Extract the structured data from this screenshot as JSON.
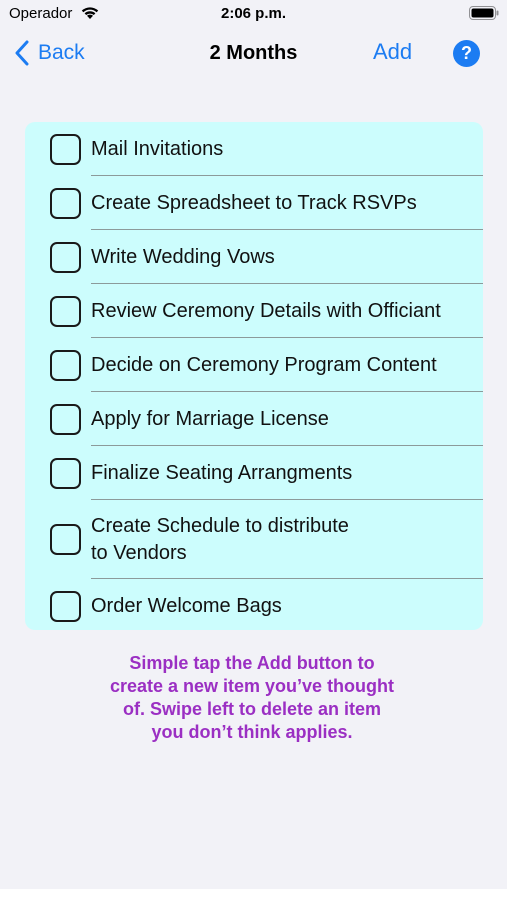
{
  "status_bar": {
    "carrier": "Operador",
    "time": "2:06 p.m."
  },
  "nav": {
    "back_label": "Back",
    "title": "2 Months",
    "add_label": "Add",
    "help_label": "?"
  },
  "checklist": {
    "items": [
      {
        "label": "Mail Invitations",
        "checked": false
      },
      {
        "label": "Create Spreadsheet to Track RSVPs",
        "checked": false
      },
      {
        "label": "Write Wedding Vows",
        "checked": false
      },
      {
        "label": "Review Ceremony Details with Officiant",
        "checked": false
      },
      {
        "label": "Decide on Ceremony Program Content",
        "checked": false
      },
      {
        "label": "Apply for Marriage License",
        "checked": false
      },
      {
        "label": "Finalize Seating Arrangments",
        "checked": false
      },
      {
        "label": "Create Schedule to distribute\nto Vendors",
        "checked": false
      },
      {
        "label": "Order Welcome Bags",
        "checked": false
      }
    ]
  },
  "hint": {
    "lines": [
      "Simple tap the Add button to",
      "create a new item you’ve thought",
      "of. Swipe left to delete an item",
      "you don’t think applies."
    ]
  },
  "colors": {
    "accent": "#1c7cf2",
    "card": "#ccfdfd",
    "hint": "#9b2fc3",
    "background": "#f2f2f7"
  }
}
